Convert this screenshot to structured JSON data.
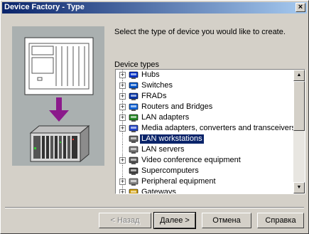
{
  "window": {
    "title": "Device Factory - Type",
    "close_glyph": "×"
  },
  "prompt": "Select the type of device you would like to create.",
  "tree": {
    "label": "Device types",
    "items": [
      {
        "label": "Hubs",
        "icon": "hub-icon",
        "expandable": true,
        "selected": false
      },
      {
        "label": "Switches",
        "icon": "switch-icon",
        "expandable": true,
        "selected": false
      },
      {
        "label": "FRADs",
        "icon": "frad-icon",
        "expandable": true,
        "selected": false
      },
      {
        "label": "Routers and Bridges",
        "icon": "router-icon",
        "expandable": true,
        "selected": false
      },
      {
        "label": "LAN adapters",
        "icon": "lan-adapter-icon",
        "expandable": true,
        "selected": false
      },
      {
        "label": "Media adapters, converters and transceivers",
        "icon": "media-adapter-icon",
        "expandable": true,
        "selected": false
      },
      {
        "label": "LAN workstations",
        "icon": "workstation-icon",
        "expandable": false,
        "selected": true
      },
      {
        "label": "LAN servers",
        "icon": "server-icon",
        "expandable": false,
        "selected": false
      },
      {
        "label": "Video conference equipment",
        "icon": "video-conference-icon",
        "expandable": true,
        "selected": false
      },
      {
        "label": "Supercomputers",
        "icon": "supercomputer-icon",
        "expandable": false,
        "selected": false
      },
      {
        "label": "Peripheral equipment",
        "icon": "peripheral-icon",
        "expandable": true,
        "selected": false
      },
      {
        "label": "Gateways",
        "icon": "gateway-icon",
        "expandable": true,
        "selected": false
      }
    ]
  },
  "buttons": {
    "back": "< Назад",
    "next": "Далее >",
    "cancel": "Отмена",
    "help": "Справка"
  },
  "colors": {
    "titlebar": "#0a246a",
    "selection": "#0a246a",
    "arrow": "#8b1a8b",
    "face": "#d4d0c8"
  }
}
